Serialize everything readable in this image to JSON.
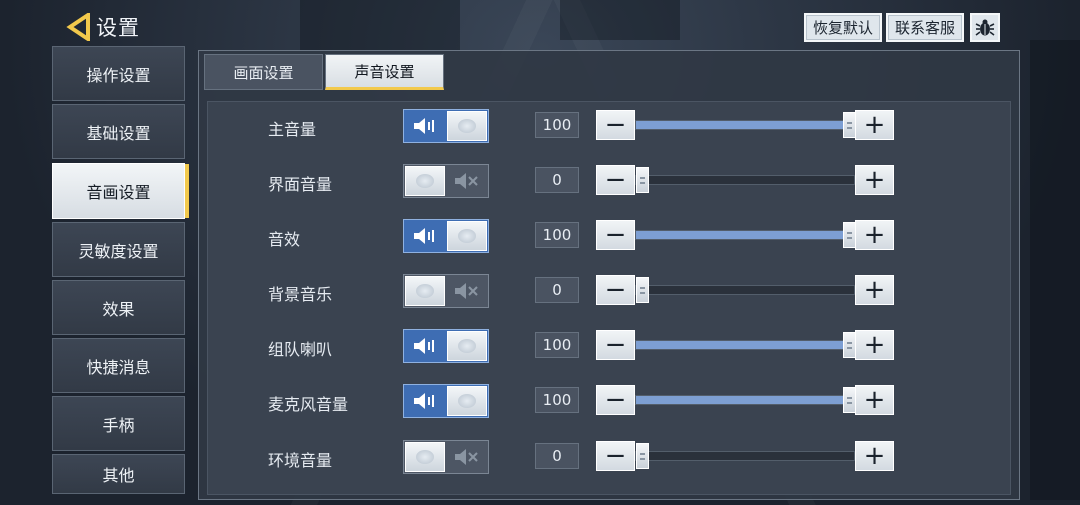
{
  "header": {
    "title": "设置",
    "restore_label": "恢复默认",
    "support_label": "联系客服",
    "back_icon": "chevron-left-icon",
    "bug_icon": "bug-icon"
  },
  "sidebar": {
    "items": [
      {
        "label": "操作设置",
        "active": false
      },
      {
        "label": "基础设置",
        "active": false
      },
      {
        "label": "音画设置",
        "active": true
      },
      {
        "label": "灵敏度设置",
        "active": false
      },
      {
        "label": "效果",
        "active": false
      },
      {
        "label": "快捷消息",
        "active": false
      },
      {
        "label": "手柄",
        "active": false
      },
      {
        "label": "其他",
        "active": false
      }
    ]
  },
  "tabs": [
    {
      "label": "画面设置",
      "active": false
    },
    {
      "label": "声音设置",
      "active": true
    }
  ],
  "audio": {
    "rows": [
      {
        "label": "主音量",
        "enabled": true,
        "value": "100"
      },
      {
        "label": "界面音量",
        "enabled": false,
        "value": "0"
      },
      {
        "label": "音效",
        "enabled": true,
        "value": "100"
      },
      {
        "label": "背景音乐",
        "enabled": false,
        "value": "0"
      },
      {
        "label": "组队喇叭",
        "enabled": true,
        "value": "100"
      },
      {
        "label": "麦克风音量",
        "enabled": true,
        "value": "100"
      },
      {
        "label": "环境音量",
        "enabled": false,
        "value": "0"
      }
    ],
    "minus_glyph": "−",
    "plus_glyph": "+"
  },
  "colors": {
    "accent": "#f2c94c",
    "toggle_on": "#3e6db3",
    "slider_fill": "#7d9fd3"
  }
}
